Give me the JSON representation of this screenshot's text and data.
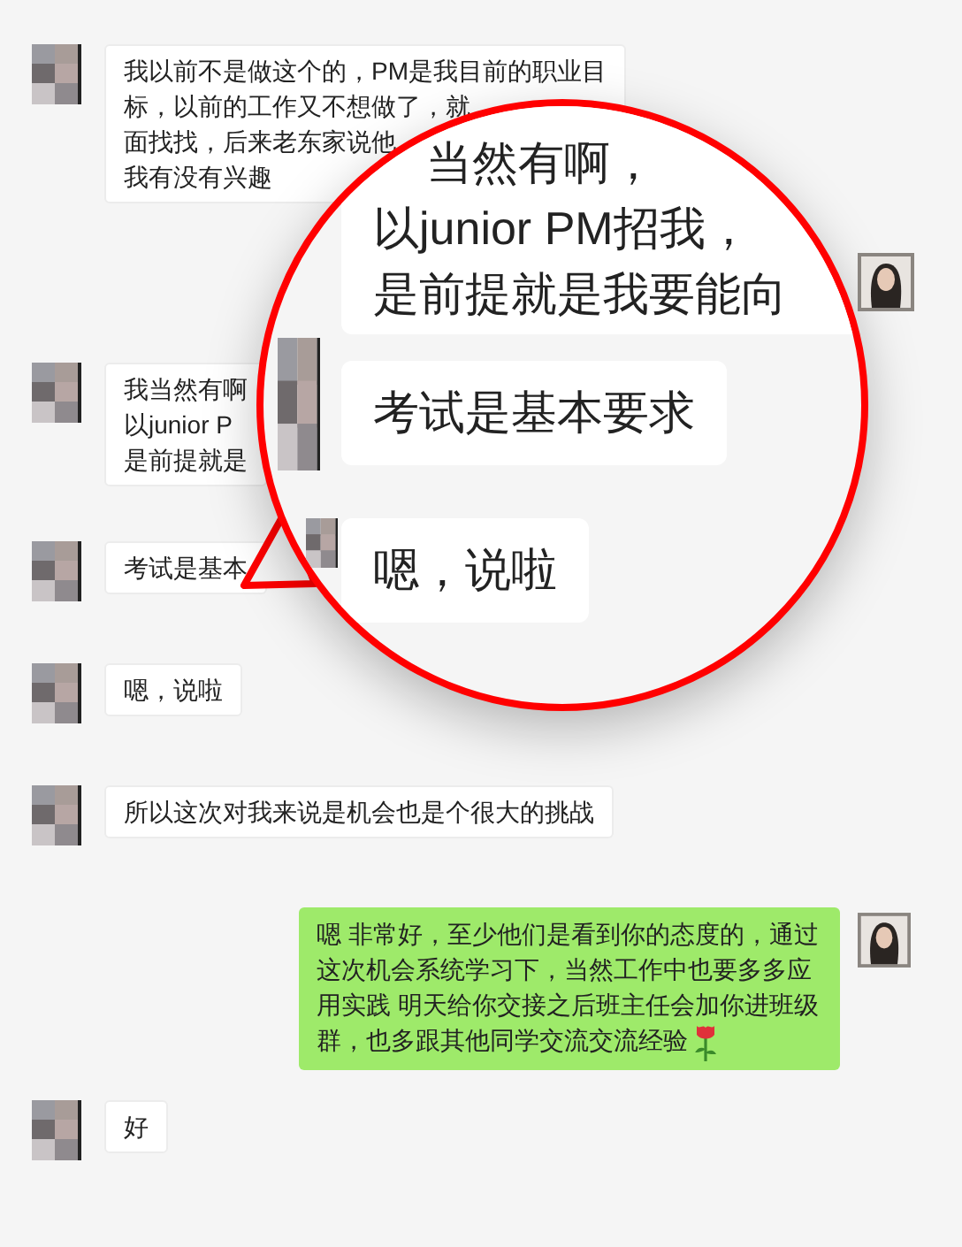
{
  "chat": [
    {
      "kind": "incoming",
      "lines": [
        "我以前不是做这个的，PM是我目前的职业目",
        "标，以前的工作又不想做了，就",
        "面找找，后来老东家说他",
        "我有没有兴趣"
      ]
    },
    {
      "kind": "incoming",
      "lines": [
        "我当然有啊",
        "以junior P",
        "是前提就是"
      ]
    },
    {
      "kind": "incoming",
      "lines": [
        "考试是基本"
      ]
    },
    {
      "kind": "incoming",
      "lines": [
        "嗯，说啦"
      ]
    },
    {
      "kind": "incoming",
      "lines": [
        "所以这次对我来说是机会也是个很大的挑战"
      ]
    },
    {
      "kind": "outgoing",
      "text": "嗯 非常好，至少他们是看到你的态度的，通过这次机会系统学习下，当然工作中也要多多应用实践 明天给你交接之后班主任会加你进班级群，也多跟其他同学交流交流经验",
      "emoji": true
    },
    {
      "kind": "incoming",
      "lines": [
        "好"
      ]
    }
  ],
  "magnifier": {
    "messages": [
      {
        "kind": "outgoing",
        "lines": [
          "当然有啊，",
          "以junior PM招我，",
          "是前提就是我要能向"
        ]
      },
      {
        "kind": "incoming",
        "lines": [
          "考试是基本要求"
        ]
      },
      {
        "kind": "incoming",
        "lines": [
          "嗯，说啦"
        ]
      }
    ]
  }
}
